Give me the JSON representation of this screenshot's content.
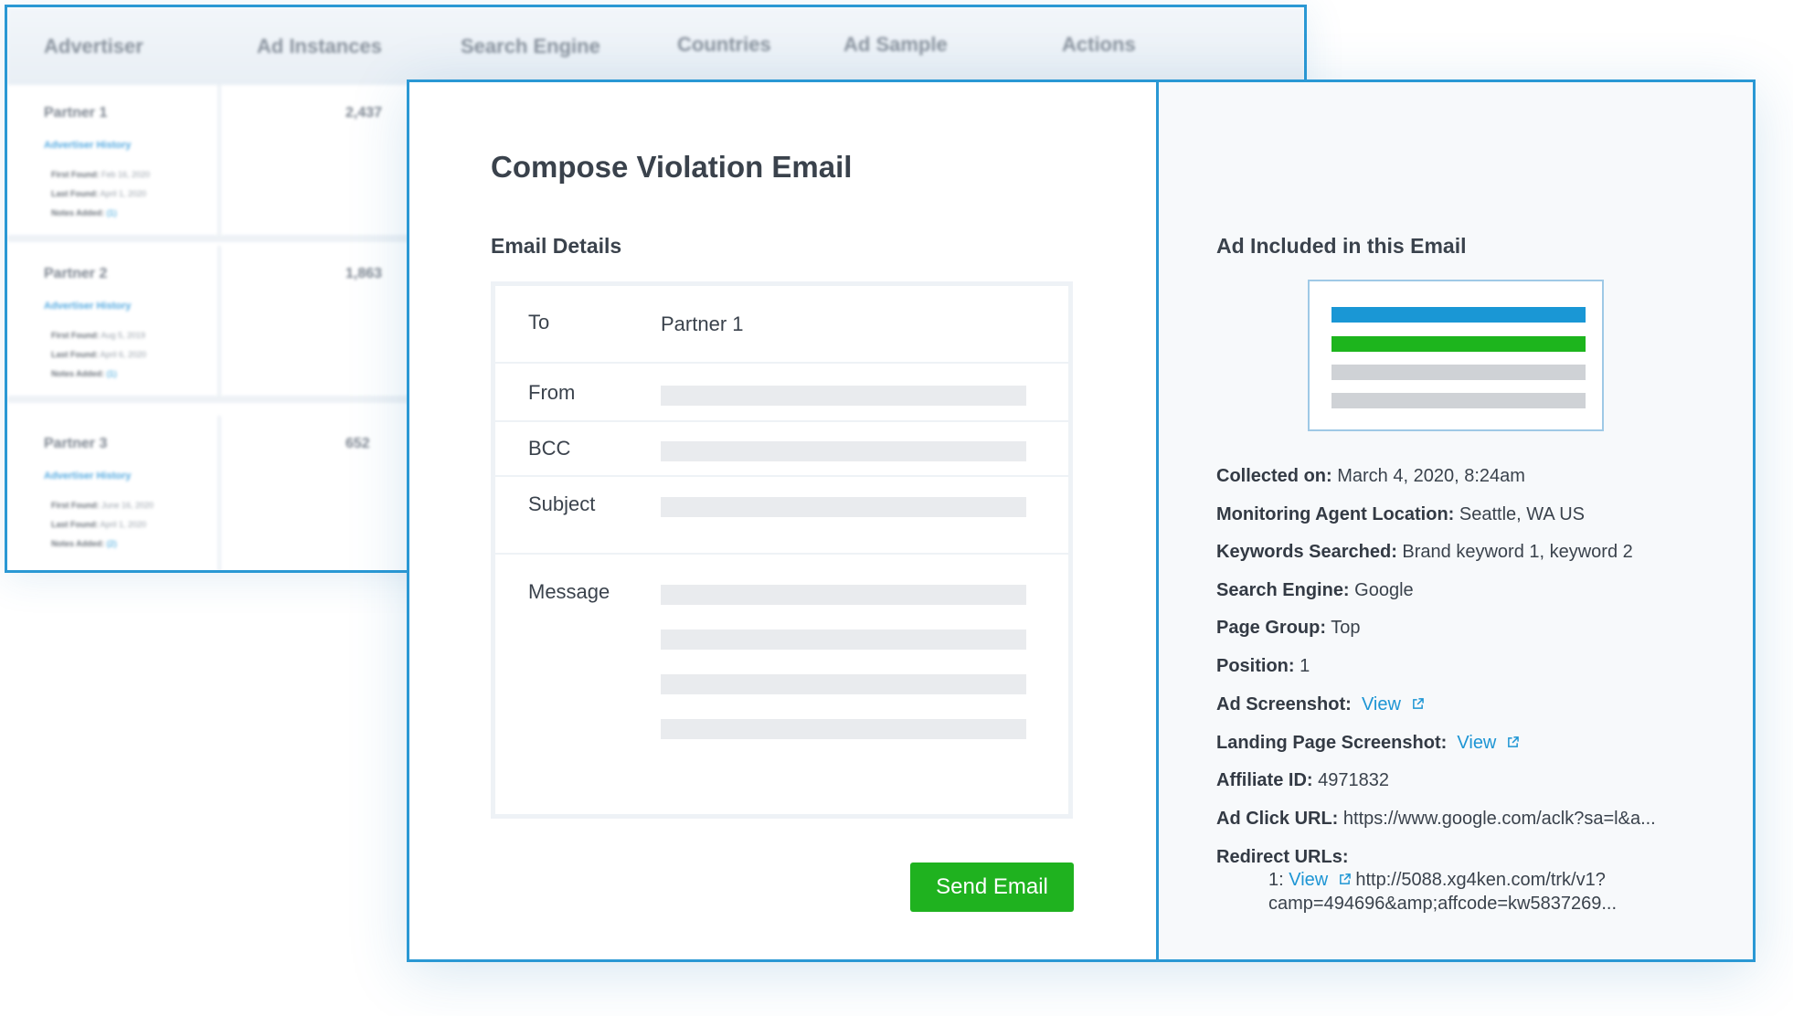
{
  "table": {
    "columns": [
      "Advertiser",
      "Ad Instances",
      "Search Engine",
      "Countries",
      "Ad Sample",
      "Actions"
    ],
    "rows": [
      {
        "name": "Partner 1",
        "history": "Advertiser History",
        "first_label": "First Found:",
        "first": "Feb 16, 2020",
        "last_label": "Last Found:",
        "last": "April 1, 2020",
        "notes_label": "Notes Added:",
        "notes": "(1)",
        "count": "2,437"
      },
      {
        "name": "Partner 2",
        "history": "Advertiser History",
        "first_label": "First Found:",
        "first": "Aug 5, 2019",
        "last_label": "Last Found:",
        "last": "April 6, 2020",
        "notes_label": "Notes Added:",
        "notes": "(1)",
        "count": "1,863"
      },
      {
        "name": "Partner 3",
        "history": "Advertiser History",
        "first_label": "First Found:",
        "first": "June 16, 2020",
        "last_label": "Last Found:",
        "last": "April 1, 2020",
        "notes_label": "Notes Added:",
        "notes": "(2)",
        "count": "652"
      }
    ]
  },
  "compose": {
    "title": "Compose Violation Email",
    "section": "Email Details",
    "to_label": "To",
    "to_value": "Partner 1",
    "from_label": "From",
    "bcc_label": "BCC",
    "subject_label": "Subject",
    "message_label": "Message",
    "send_label": "Send Email"
  },
  "ad": {
    "title": "Ad Included in this Email",
    "preview_colors": [
      "#1a97d5",
      "#1db51d",
      "#cfd2d6",
      "#cfd2d6"
    ],
    "collected_label": "Collected on:",
    "collected": "March 4, 2020, 8:24am",
    "location_label": "Monitoring Agent Location:",
    "location": "Seattle, WA US",
    "keywords_label": "Keywords Searched:",
    "keywords": "Brand keyword 1, keyword 2",
    "engine_label": "Search Engine:",
    "engine": "Google",
    "pagegroup_label": "Page Group:",
    "pagegroup": "Top",
    "position_label": "Position:",
    "position": "1",
    "ad_screenshot_label": "Ad Screenshot:",
    "landing_screenshot_label": "Landing Page Screenshot:",
    "view_label": "View",
    "affiliate_label": "Affiliate ID:",
    "affiliate": "4971832",
    "click_url_label": "Ad Click URL:",
    "click_url": "https://www.google.com/aclk?sa=l&a...",
    "redirect_label": "Redirect URLs:",
    "redirect_index": "1:",
    "redirect_url_line1": "http://5088.xg4ken.com/trk/v1?",
    "redirect_url_line2": "camp=494696&amp;affcode=kw5837269..."
  },
  "colors": {
    "accent": "#2a98d4",
    "link": "#1d95d4",
    "send_button": "#1fb21f"
  }
}
